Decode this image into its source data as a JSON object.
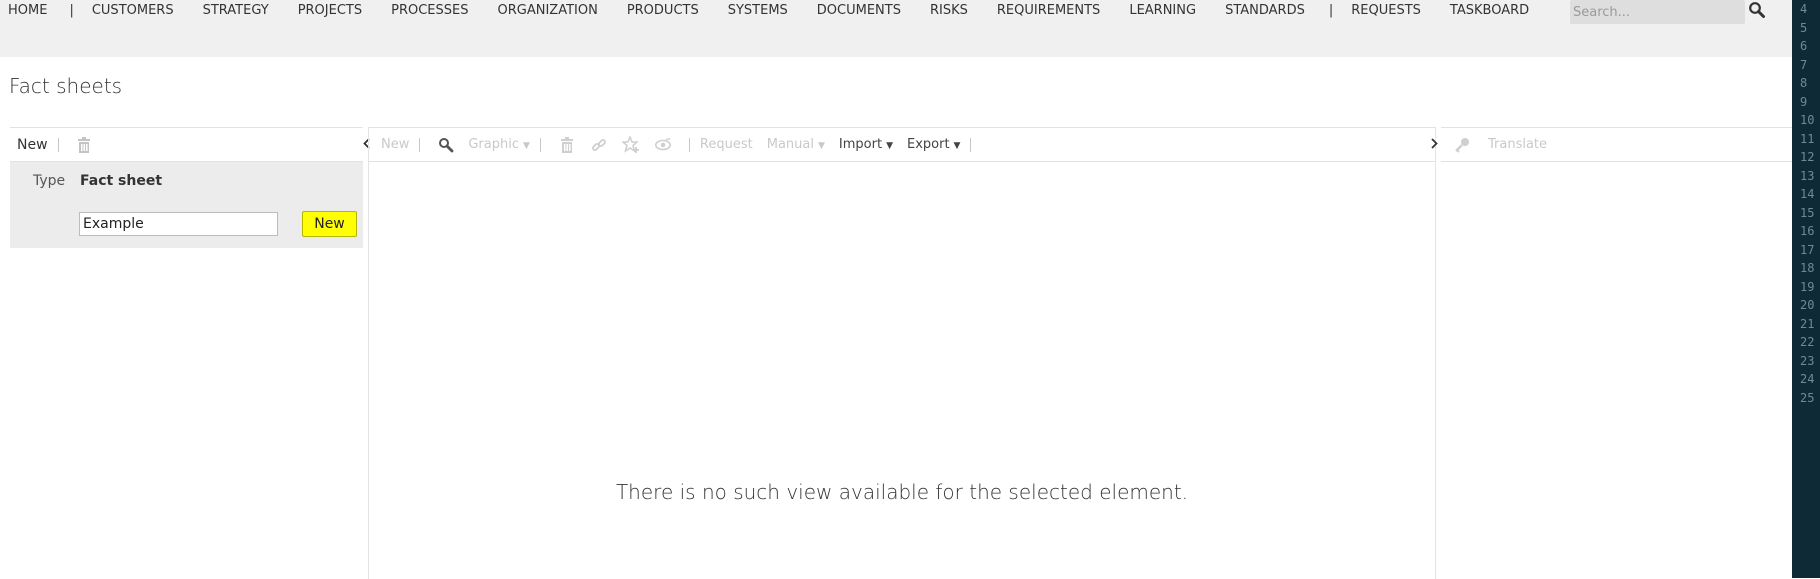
{
  "nav": {
    "items": [
      "HOME",
      "CUSTOMERS",
      "STRATEGY",
      "PROJECTS",
      "PROCESSES",
      "ORGANIZATION",
      "PRODUCTS",
      "SYSTEMS",
      "DOCUMENTS",
      "RISKS",
      "REQUIREMENTS",
      "LEARNING",
      "STANDARDS",
      "REQUESTS",
      "TASKBOARD"
    ],
    "separator": "|"
  },
  "search": {
    "placeholder": "Search..."
  },
  "page": {
    "title": "Fact sheets"
  },
  "left_panel": {
    "toolbar": {
      "new_label": "New"
    },
    "create": {
      "type_label": "Type",
      "type_value": "Fact sheet",
      "name_value": "Example",
      "new_button_label": "New"
    }
  },
  "center_panel": {
    "toolbar": {
      "new_label": "New",
      "graphic_label": "Graphic",
      "request_label": "Request",
      "manual_label": "Manual",
      "import_label": "Import",
      "export_label": "Export"
    },
    "empty_message": "There is no such view available for the selected element."
  },
  "right_panel": {
    "toolbar": {
      "translate_label": "Translate"
    }
  },
  "colors": {
    "highlight_button": "#ffff00",
    "topbar": "#f0f0f0",
    "editor_strip": "#0f2a37"
  },
  "editor_gutter": {
    "line_numbers": [
      "4",
      "5",
      "6",
      "7",
      "8",
      "9",
      "10",
      "11",
      "12",
      "13",
      "14",
      "15",
      "16",
      "17",
      "18",
      "19",
      "20",
      "21",
      "22",
      "23",
      "24",
      "25"
    ]
  }
}
